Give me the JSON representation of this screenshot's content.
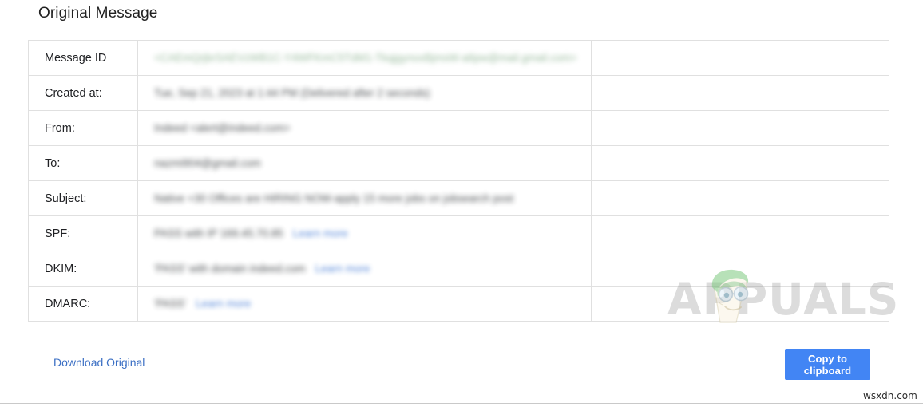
{
  "page": {
    "title": "Original Message"
  },
  "table": {
    "rows": [
      {
        "label": "Message ID",
        "value": "<CAEmQrjbrSAEVzWB1C-Y4WFKmC5TdM1-TkqjgynoxBjmsW-a6pw@mail.gmail.com>",
        "value_style": "green",
        "link": ""
      },
      {
        "label": "Created at:",
        "value": "Tue, Sep 21, 2023 at 1:44 PM (Delivered after 2 seconds)",
        "value_style": "dark",
        "link": ""
      },
      {
        "label": "From:",
        "value": "Indeed <alert@indeed.com>",
        "value_style": "dark",
        "link": ""
      },
      {
        "label": "To:",
        "value": "nazmi904@gmail.com",
        "value_style": "dark",
        "link": ""
      },
      {
        "label": "Subject:",
        "value": "Native +30 Offices are HIRING NOW-apply 15 more jobs on jobsearch post",
        "value_style": "dark",
        "link": ""
      },
      {
        "label": "SPF:",
        "value": "PASS with IP 169.45.70.85",
        "value_style": "dark",
        "link": "Learn more"
      },
      {
        "label": "DKIM:",
        "value": "'PASS' with domain indeed.com",
        "value_style": "dark",
        "link": "Learn more"
      },
      {
        "label": "DMARC:",
        "value": "'PASS'",
        "value_style": "dark",
        "link": "Learn more"
      }
    ]
  },
  "footer": {
    "download_label": "Download Original",
    "copy_label": "Copy to clipboard"
  },
  "watermarks": {
    "brand": "APPUALS",
    "site": "wsxdn.com"
  },
  "colors": {
    "accent_blue": "#4285f4",
    "link_blue": "#3b6fc4",
    "border": "#e0e0e0",
    "text": "#202124"
  }
}
